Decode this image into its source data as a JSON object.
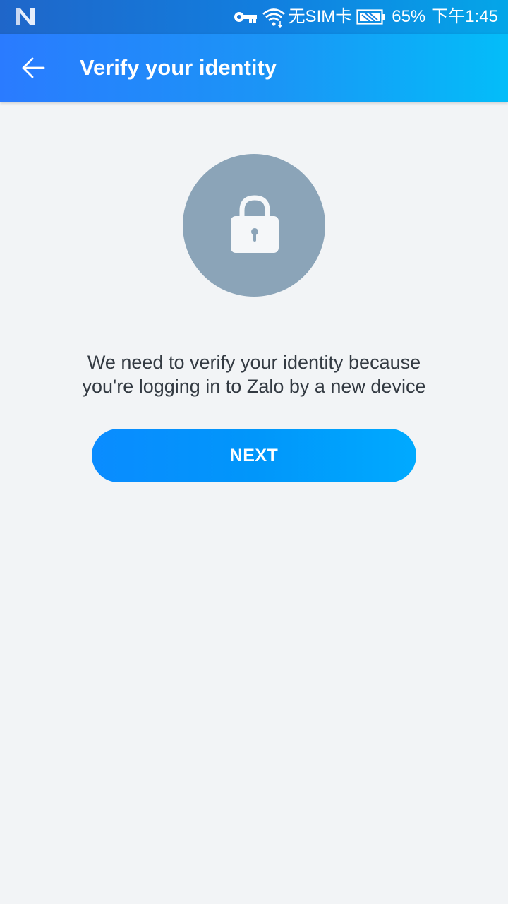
{
  "status_bar": {
    "left_icon": "n-notification-icon",
    "icons": [
      "key-icon",
      "wifi-icon",
      "battery-icon"
    ],
    "sim_text": "无SIM卡",
    "battery_percent": "65%",
    "time": "下午1:45"
  },
  "app_bar": {
    "back_icon": "back-arrow-icon",
    "title": "Verify your identity"
  },
  "main": {
    "hero_icon": "lock-icon",
    "message_line1": "We need to verify your identity because",
    "message_line2": "you're logging in to Zalo by a new device",
    "next_label": "NEXT"
  },
  "colors": {
    "app_bar_start": "#2a7bff",
    "app_bar_end": "#03bdf9",
    "button_start": "#0a8cff",
    "button_end": "#00aaff",
    "lock_circle": "#8ba4b8",
    "background": "#f2f4f6",
    "text": "#333a42"
  }
}
